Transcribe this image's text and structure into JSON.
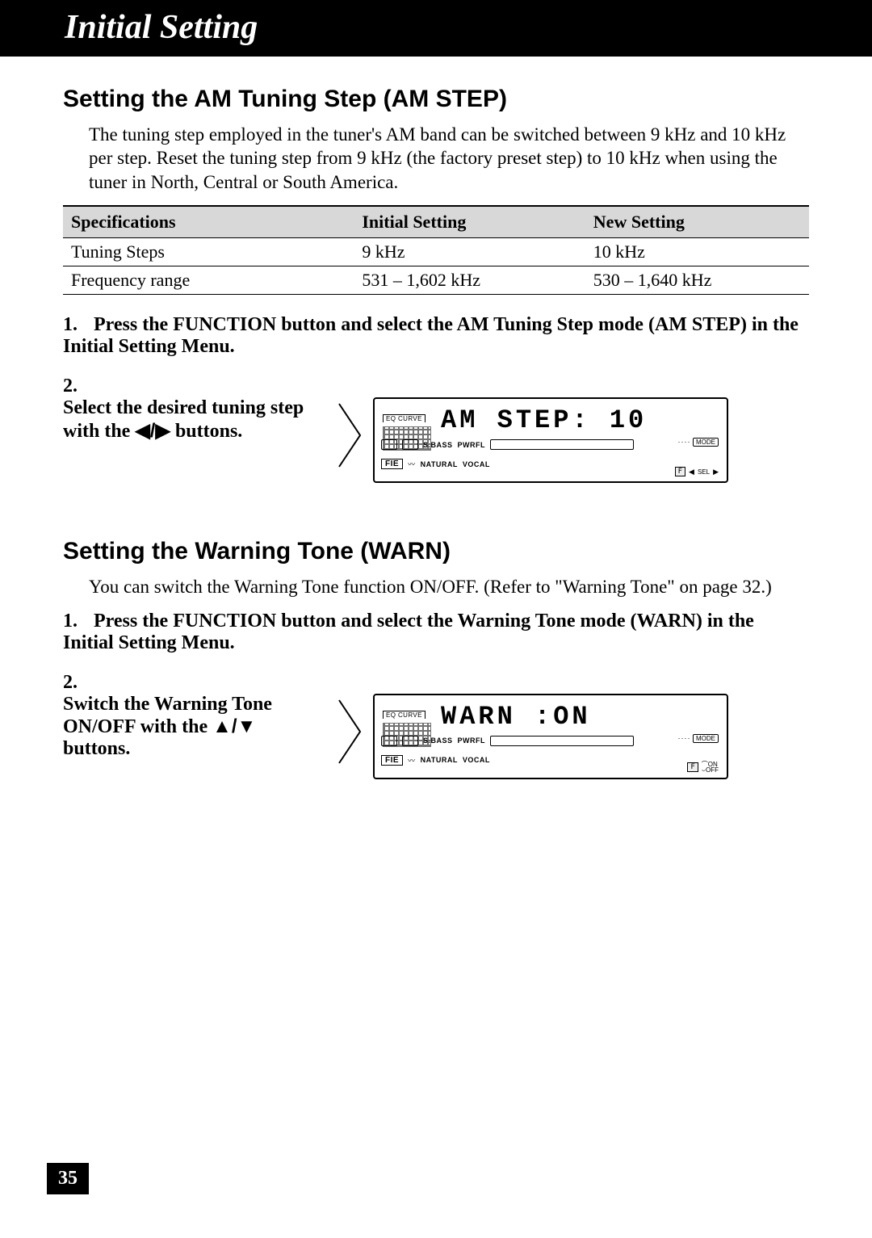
{
  "header": {
    "title": "Initial Setting"
  },
  "page_number": "35",
  "sections": [
    {
      "title": "Setting the AM Tuning Step (AM STEP)",
      "intro": "The tuning step employed in the tuner's AM band can be switched between 9 kHz and 10 kHz per step. Reset the tuning step from 9 kHz (the factory preset step) to 10 kHz when using the tuner in North, Central or South America.",
      "table": {
        "headers": [
          "Specifications",
          "Initial Setting",
          "New Setting"
        ],
        "rows": [
          [
            "Tuning Steps",
            "9 kHz",
            "10 kHz"
          ],
          [
            "Frequency range",
            "531 – 1,602 kHz",
            "530 – 1,640 kHz"
          ]
        ]
      },
      "steps": [
        {
          "text": "Press the FUNCTION button and select the AM Tuning Step mode (AM STEP) in the Initial Setting Menu."
        },
        {
          "text_prefix": "Select the desired tuning step with the ",
          "buttons_glyph": "◀/▶",
          "text_suffix": " buttons.",
          "display": {
            "main": "AM  STEP:  10",
            "row2_labels": [
              "S.BASS",
              "PWRFL"
            ],
            "row3_labels": [
              "FIE",
              "NATURAL",
              "VOCAL"
            ],
            "mode_label": "MODE",
            "sel_label": "SEL",
            "f_label": "F",
            "eq_label": "EQ CURVE"
          }
        }
      ]
    },
    {
      "title": "Setting the Warning Tone (WARN)",
      "intro": "You can switch the Warning Tone function ON/OFF. (Refer to \"Warning Tone\" on page 32.)",
      "steps": [
        {
          "text": "Press the FUNCTION button and select the Warning Tone mode (WARN) in the Initial Setting Menu."
        },
        {
          "text_prefix": "Switch the Warning Tone ON/OFF with the ",
          "buttons_glyph": "▲/▼",
          "text_suffix": " buttons.",
          "display": {
            "main": "WARN   :ON",
            "row2_labels": [
              "S.BASS",
              "PWRFL"
            ],
            "row3_labels": [
              "FIE",
              "NATURAL",
              "VOCAL"
            ],
            "mode_label": "MODE",
            "on_label": "ON",
            "off_label": "OFF",
            "f_label": "F",
            "eq_label": "EQ CURVE"
          }
        }
      ]
    }
  ],
  "icons": {
    "triangle_arrow": "right-chevron-outline"
  }
}
